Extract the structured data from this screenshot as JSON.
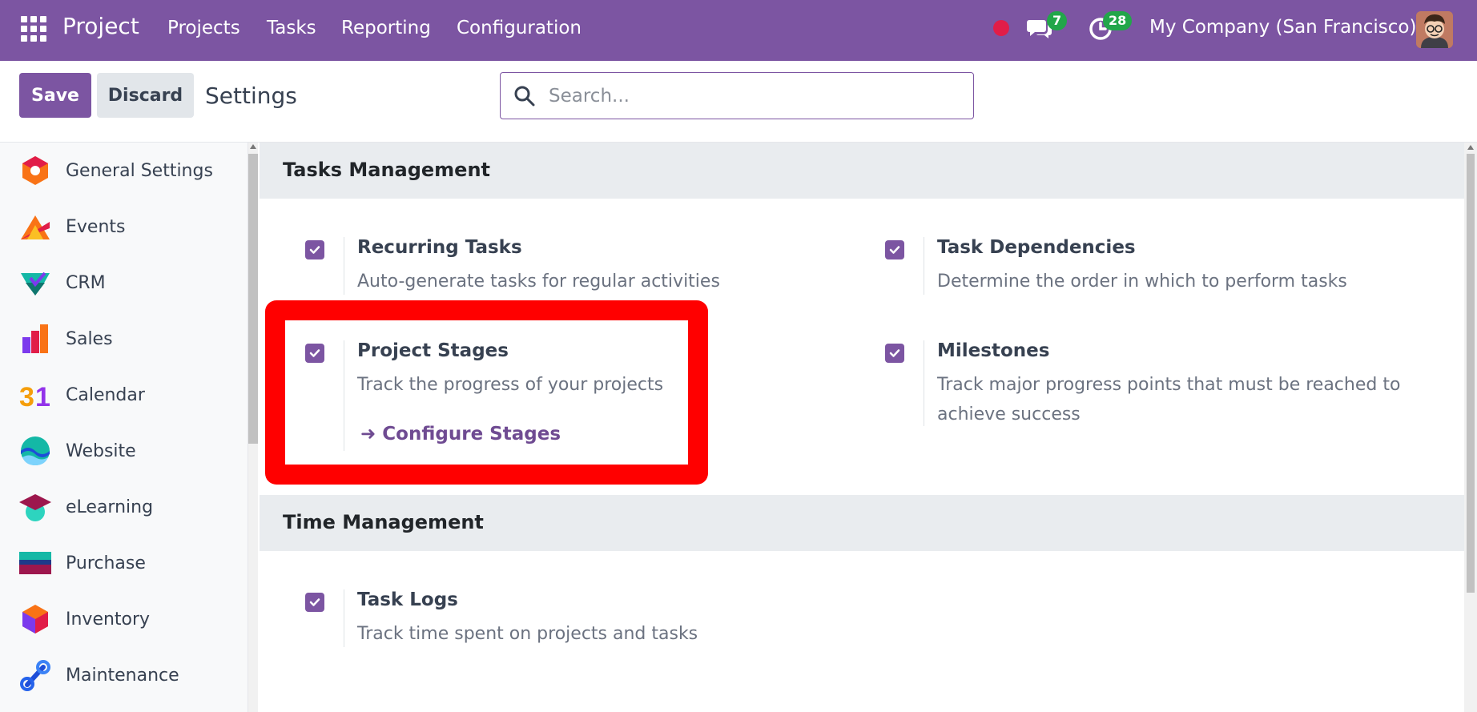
{
  "navbar": {
    "brand": "Project",
    "menu": [
      "Projects",
      "Tasks",
      "Reporting",
      "Configuration"
    ],
    "messages_count": "7",
    "activities_count": "28",
    "company": "My Company (San Francisco)"
  },
  "control_panel": {
    "save_label": "Save",
    "discard_label": "Discard",
    "title": "Settings",
    "search_placeholder": "Search..."
  },
  "sidebar": {
    "items": [
      {
        "label": "General Settings",
        "icon": "general-settings-icon"
      },
      {
        "label": "Events",
        "icon": "events-icon"
      },
      {
        "label": "CRM",
        "icon": "crm-icon"
      },
      {
        "label": "Sales",
        "icon": "sales-icon"
      },
      {
        "label": "Calendar",
        "icon": "calendar-icon"
      },
      {
        "label": "Website",
        "icon": "website-icon"
      },
      {
        "label": "eLearning",
        "icon": "elearning-icon"
      },
      {
        "label": "Purchase",
        "icon": "purchase-icon"
      },
      {
        "label": "Inventory",
        "icon": "inventory-icon"
      },
      {
        "label": "Maintenance",
        "icon": "maintenance-icon"
      }
    ]
  },
  "sections": {
    "tasks_management": {
      "title": "Tasks Management",
      "recurring": {
        "title": "Recurring Tasks",
        "desc": "Auto-generate tasks for regular activities",
        "checked": true
      },
      "dependencies": {
        "title": "Task Dependencies",
        "desc": "Determine the order in which to perform tasks",
        "checked": true
      },
      "stages": {
        "title": "Project Stages",
        "desc": "Track the progress of your projects",
        "link": "Configure Stages",
        "checked": true
      },
      "milestones": {
        "title": "Milestones",
        "desc": "Track major progress points that must be reached to achieve success",
        "checked": true
      }
    },
    "time_management": {
      "title": "Time Management",
      "task_logs": {
        "title": "Task Logs",
        "desc": "Track time spent on projects and tasks",
        "checked": true
      }
    }
  },
  "colors": {
    "brand": "#7c55a2",
    "highlight": "#ff0000",
    "badge": "#22a64a",
    "status_dot": "#e11d48"
  }
}
